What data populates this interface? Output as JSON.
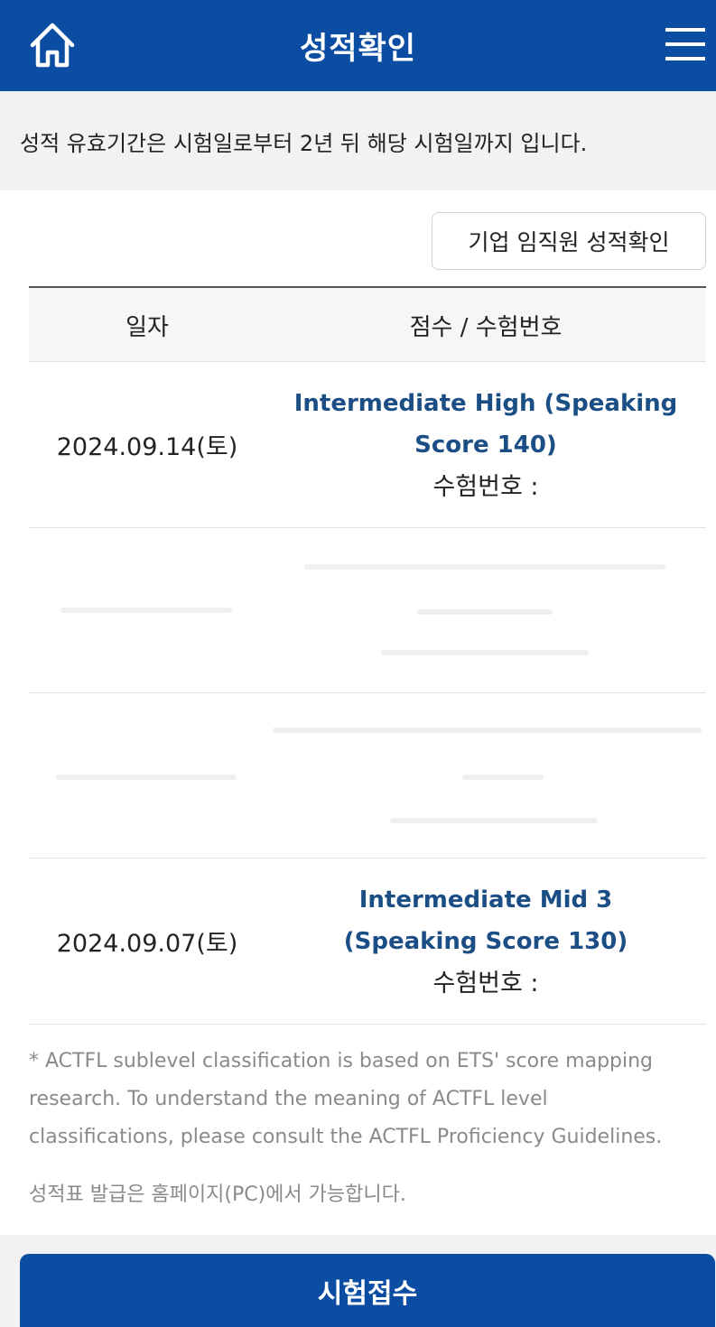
{
  "header": {
    "title": "성적확인",
    "home_icon": "home-icon",
    "menu_icon": "hamburger-menu-icon",
    "background": "#0b4da2"
  },
  "notice": {
    "text": "성적 유효기간은 시험일로부터 2년 뒤 해당 시험일까지 입니다."
  },
  "corp_button": {
    "label": "기업 임직원 성적확인"
  },
  "table": {
    "headers": {
      "date": "일자",
      "score": "점수 / 수험번호"
    },
    "rows": [
      {
        "date": "2024.09.14(토)",
        "score": "Intermediate High (Speaking Score 140)",
        "exam_no_label": "수험번호 :"
      },
      {
        "date": "2024.09.07(토)",
        "score": "Intermediate Mid 3 (Speaking Score 130)",
        "exam_no_label": "수험번호 :"
      }
    ]
  },
  "footnote": "* ACTFL sublevel classification is based on ETS' score mapping research. To understand the meaning of ACTFL level classifications, please consult the ACTFL Proficiency Guidelines.",
  "note2": "성적표 발급은 홈페이지(PC)에서 가능합니다.",
  "apply_button": {
    "label": "시험접수"
  },
  "colors": {
    "primary": "#0b4da2",
    "score_link": "#1c4e86"
  }
}
